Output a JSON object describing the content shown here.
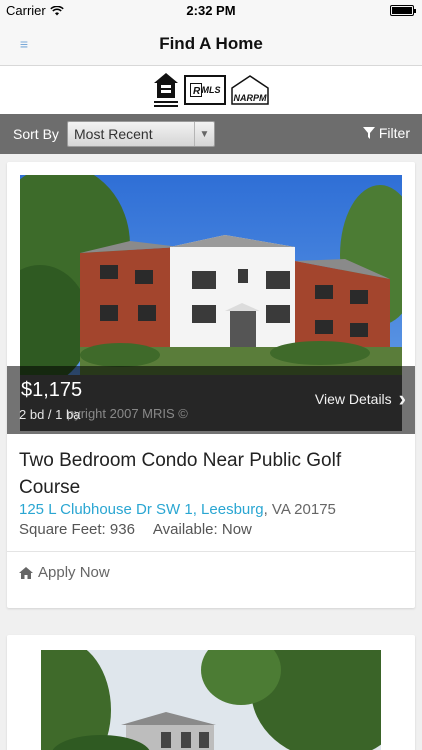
{
  "status_bar": {
    "carrier": "Carrier",
    "time": "2:32 PM"
  },
  "nav": {
    "title": "Find A Home",
    "menu_icon": "hamburger-icon"
  },
  "logos": {
    "eho_text": "EQUAL HOUSING OPPORTUNITY",
    "mls_text": "MLS",
    "narpm_text": "NARPM"
  },
  "sort": {
    "label": "Sort By",
    "selected": "Most Recent",
    "filter_label": "Filter"
  },
  "listings": [
    {
      "price": "$1,175",
      "beds_baths": "2 bd / 1 ba",
      "watermark": "pyright 2007 MRIS ©",
      "view_details": "View Details",
      "title": "Two Bedroom Condo Near Public Golf Course",
      "address_link": "125 L Clubhouse Dr SW 1, Leesburg",
      "address_rest": ", VA 20175",
      "square_feet": "Square Feet: 936",
      "available": "Available: Now",
      "apply": "Apply Now"
    }
  ],
  "colors": {
    "accent": "#2aa6d2",
    "sort_bar": "#6d6d6d"
  }
}
